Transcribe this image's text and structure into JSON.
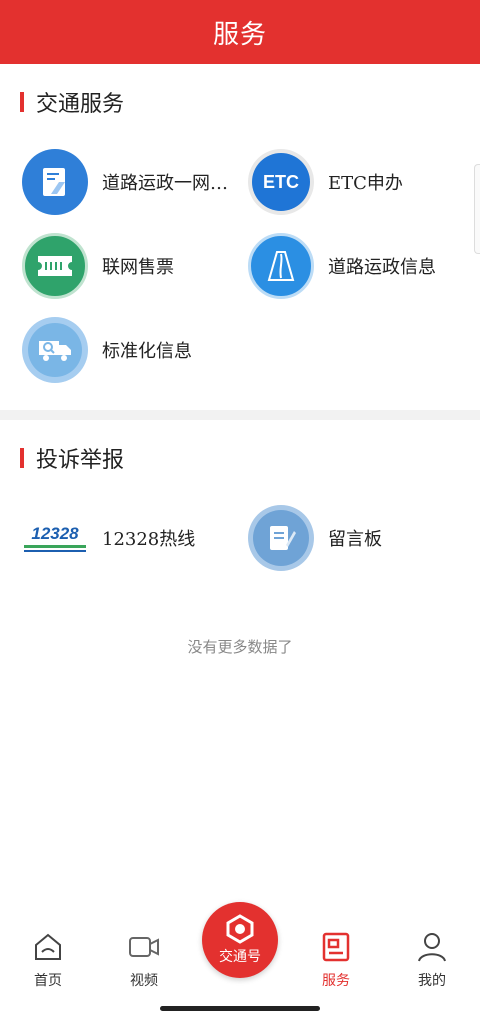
{
  "header": {
    "title": "服务"
  },
  "traffic_services": {
    "title": "交通服务",
    "items": [
      {
        "label": "道路运政一网…",
        "icon": "document-road-icon",
        "color": "#2f7fd8"
      },
      {
        "label": "ETC申办",
        "icon": "etc-icon",
        "icon_text": "ETC",
        "color": "#1f75d6"
      },
      {
        "label": "联网售票",
        "icon": "ticket-icon",
        "color": "#2fa36b"
      },
      {
        "label": "道路运政信息",
        "icon": "road-icon",
        "color": "#2b8fe3"
      },
      {
        "label": "标准化信息",
        "icon": "truck-search-icon",
        "color": "#7ab6e6"
      }
    ]
  },
  "complaints": {
    "title": "投诉举报",
    "items": [
      {
        "label": "12328热线",
        "icon": "hotline-12328-logo",
        "logo_text": "12328"
      },
      {
        "label": "留言板",
        "icon": "message-board-icon",
        "color": "#6fa3d6"
      }
    ]
  },
  "no_more": "没有更多数据了",
  "tabbar": {
    "home": "首页",
    "video": "视频",
    "center": "交通号",
    "service": "服务",
    "mine": "我的"
  },
  "colors": {
    "accent": "#e3312f"
  }
}
